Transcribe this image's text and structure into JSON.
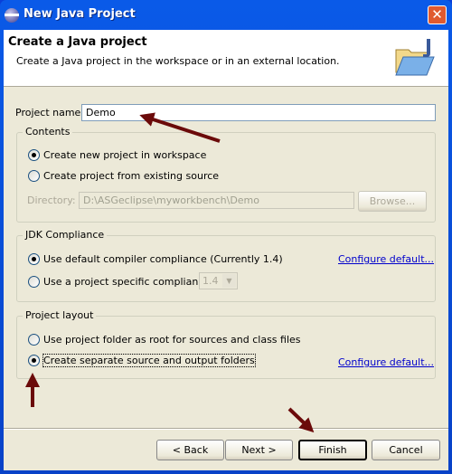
{
  "window": {
    "title": "New Java Project",
    "icon": "eclipse-icon",
    "close_icon": "close-icon"
  },
  "header": {
    "title": "Create a Java project",
    "description": "Create a Java project in the workspace or in an external location.",
    "icon": "java-folder-icon"
  },
  "project_name": {
    "label": "Project name:",
    "value": "Demo"
  },
  "contents": {
    "legend": "Contents",
    "options": [
      {
        "label": "Create new project in workspace",
        "selected": true
      },
      {
        "label": "Create project from existing source",
        "selected": false
      }
    ],
    "directory_label": "Directory:",
    "directory_value": "D:\\ASGeclipse\\myworkbench\\Demo",
    "browse": "Browse..."
  },
  "jdk": {
    "legend": "JDK Compliance",
    "options": [
      {
        "label": "Use default compiler compliance (Currently 1.4)",
        "selected": true
      },
      {
        "label": "Use a project specific compliance:",
        "selected": false
      }
    ],
    "compliance_value": "1.4",
    "configure": "Configure default..."
  },
  "layout": {
    "legend": "Project layout",
    "options": [
      {
        "label": "Use project folder as root for sources and class files",
        "selected": false
      },
      {
        "label": "Create separate source and output folders",
        "selected": true
      }
    ],
    "configure": "Configure default..."
  },
  "buttons": {
    "back": "< Back",
    "next": "Next >",
    "finish": "Finish",
    "cancel": "Cancel"
  },
  "colors": {
    "annotation_arrow": "#6b0a0a",
    "titlebar": "#0a5ae8",
    "link": "#0000cc"
  }
}
